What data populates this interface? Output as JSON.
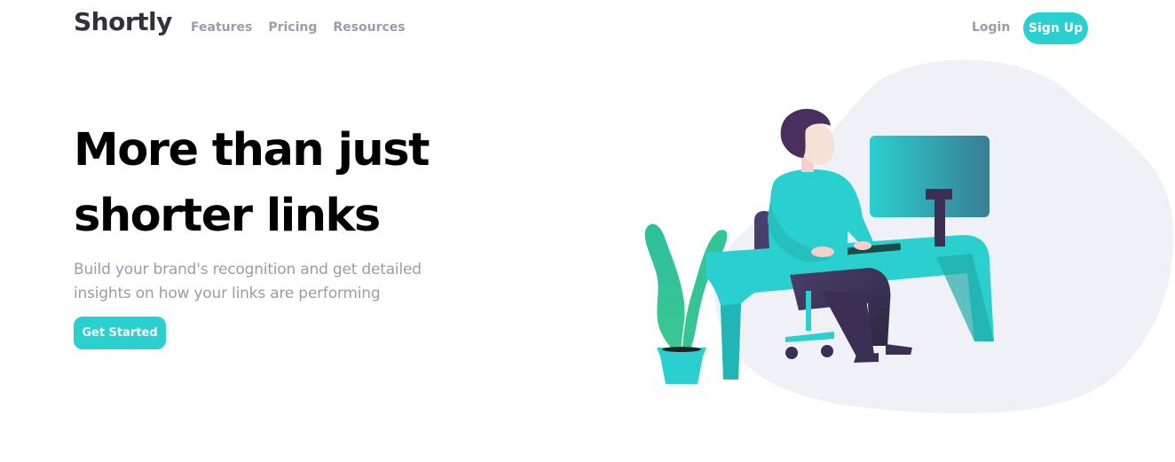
{
  "header": {
    "logo": "Shortly",
    "nav": [
      {
        "label": "Features"
      },
      {
        "label": "Pricing"
      },
      {
        "label": "Resources"
      }
    ],
    "login_label": "Login",
    "signup_label": "Sign Up"
  },
  "hero": {
    "title_line1": "More than just",
    "title_line2": "shorter links",
    "subtitle": "Build your brand's recognition and get detailed insights on how your links are performing",
    "cta_label": "Get Started"
  },
  "colors": {
    "primary": "#2acfcf",
    "dark_violet": "#3b3054",
    "grayish_violet": "#9e9aa7",
    "blob": "#f0f1f6"
  },
  "icons": {
    "illustration": "person-working-at-desk-illustration"
  }
}
